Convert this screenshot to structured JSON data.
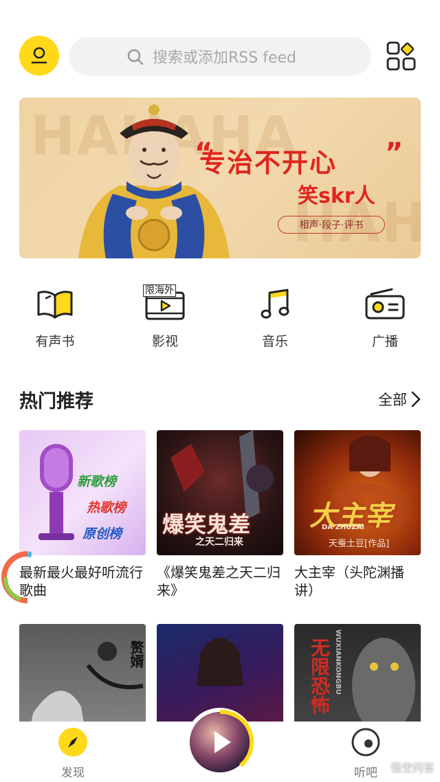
{
  "search": {
    "placeholder": "搜索或添加RSS feed"
  },
  "banner": {
    "bg_text_1": "HAHAHA",
    "bg_text_2": "HAH",
    "quote_open": "“",
    "quote_close": "”",
    "headline": "专治不开心",
    "subtitle": "笑skr人",
    "tag": "相声·段子·评书"
  },
  "categories": [
    {
      "label": "有声书",
      "icon": "book-icon"
    },
    {
      "label": "影视",
      "icon": "video-icon",
      "badge": "限海外"
    },
    {
      "label": "音乐",
      "icon": "music-note-icon"
    },
    {
      "label": "广播",
      "icon": "radio-icon"
    }
  ],
  "section": {
    "title": "热门推荐",
    "more": "全部"
  },
  "cards": [
    {
      "title": "最新最火最好听流行歌曲",
      "cover_lines": [
        "新歌榜",
        "热歌榜",
        "原创榜"
      ]
    },
    {
      "title": "《爆笑鬼差之天二归来》",
      "cover_lines": [
        "爆笑鬼差",
        "之天二归来"
      ]
    },
    {
      "title": "大主宰（头陀渊播讲）",
      "cover_lines": [
        "大主宰",
        "DA ZHUZAI",
        "天蚕土豆[作品]"
      ]
    },
    {
      "title": "",
      "cover_lines": [
        "赘婿"
      ]
    },
    {
      "title": "",
      "cover_lines": []
    },
    {
      "title": "",
      "cover_lines": [
        "无限恐怖",
        "WUXIANKONGBU"
      ]
    }
  ],
  "nav": {
    "discover": "发现",
    "listen": "听吧"
  },
  "watermark": "悟空问答",
  "colors": {
    "accent": "#FFD91A",
    "banner_red": "#E0251E"
  }
}
